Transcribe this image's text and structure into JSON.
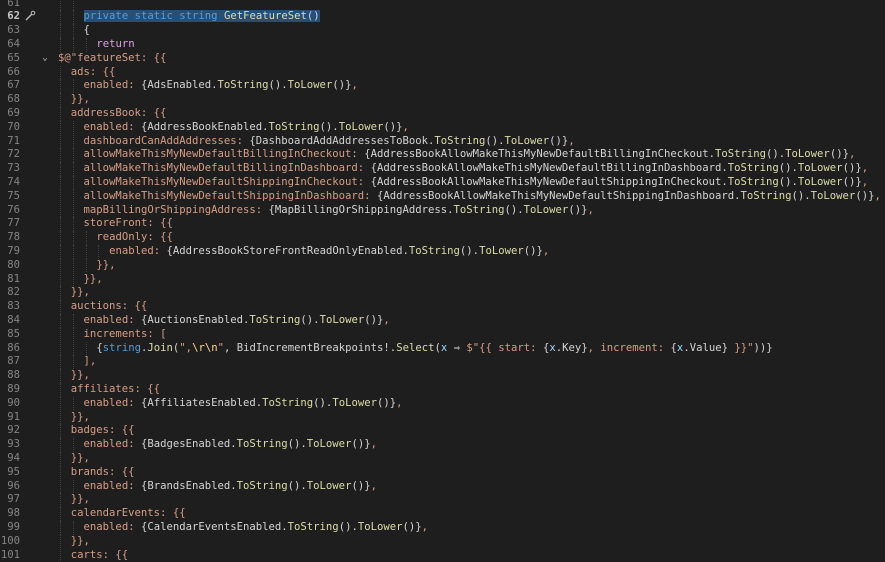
{
  "editor": {
    "active_line": 62,
    "lines": [
      {
        "n": 61,
        "indent": 4,
        "segs": []
      },
      {
        "n": 62,
        "indent": 4,
        "segs": [
          [
            "kw",
            "private"
          ],
          [
            "pl",
            " "
          ],
          [
            "kw",
            "static"
          ],
          [
            "pl",
            " "
          ],
          [
            "kw",
            "string"
          ],
          [
            "pl",
            " "
          ],
          [
            "fn",
            "GetFeatureSet"
          ],
          [
            "pl",
            "()"
          ]
        ],
        "selected": true
      },
      {
        "n": 63,
        "indent": 4,
        "segs": [
          [
            "pl",
            "{"
          ]
        ]
      },
      {
        "n": 64,
        "indent": 6,
        "segs": [
          [
            "ctl",
            "return"
          ]
        ]
      },
      {
        "n": 65,
        "indent": 0,
        "segs": [
          [
            "str",
            "$@\"featureSet: {{"
          ]
        ],
        "fold": true
      },
      {
        "n": 66,
        "indent": 2,
        "segs": [
          [
            "txt",
            "ads: {{"
          ]
        ]
      },
      {
        "n": 67,
        "indent": 4,
        "segs": [
          [
            "txt",
            "enabled: "
          ],
          [
            "pl",
            "{AdsEnabled."
          ],
          [
            "fn",
            "ToString"
          ],
          [
            "pl",
            "()."
          ],
          [
            "fn",
            "ToLower"
          ],
          [
            "pl",
            "()}"
          ],
          [
            "txt",
            ","
          ]
        ]
      },
      {
        "n": 68,
        "indent": 2,
        "segs": [
          [
            "txt",
            "}},"
          ]
        ]
      },
      {
        "n": 69,
        "indent": 2,
        "segs": [
          [
            "txt",
            "addressBook: {{"
          ]
        ]
      },
      {
        "n": 70,
        "indent": 4,
        "segs": [
          [
            "txt",
            "enabled: "
          ],
          [
            "pl",
            "{AddressBookEnabled."
          ],
          [
            "fn",
            "ToString"
          ],
          [
            "pl",
            "()."
          ],
          [
            "fn",
            "ToLower"
          ],
          [
            "pl",
            "()}"
          ],
          [
            "txt",
            ","
          ]
        ]
      },
      {
        "n": 71,
        "indent": 4,
        "segs": [
          [
            "txt",
            "dashboardCanAddAddresses: "
          ],
          [
            "pl",
            "{DashboardAddAddressesToBook."
          ],
          [
            "fn",
            "ToString"
          ],
          [
            "pl",
            "()."
          ],
          [
            "fn",
            "ToLower"
          ],
          [
            "pl",
            "()}"
          ],
          [
            "txt",
            ","
          ]
        ]
      },
      {
        "n": 72,
        "indent": 4,
        "segs": [
          [
            "txt",
            "allowMakeThisMyNewDefaultBillingInCheckout: "
          ],
          [
            "pl",
            "{AddressBookAllowMakeThisMyNewDefaultBillingInCheckout."
          ],
          [
            "fn",
            "ToString"
          ],
          [
            "pl",
            "()."
          ],
          [
            "fn",
            "ToLower"
          ],
          [
            "pl",
            "()}"
          ],
          [
            "txt",
            ","
          ]
        ]
      },
      {
        "n": 73,
        "indent": 4,
        "segs": [
          [
            "txt",
            "allowMakeThisMyNewDefaultBillingInDashboard: "
          ],
          [
            "pl",
            "{AddressBookAllowMakeThisMyNewDefaultBillingInDashboard."
          ],
          [
            "fn",
            "ToString"
          ],
          [
            "pl",
            "()."
          ],
          [
            "fn",
            "ToLower"
          ],
          [
            "pl",
            "()}"
          ],
          [
            "txt",
            ","
          ]
        ]
      },
      {
        "n": 74,
        "indent": 4,
        "segs": [
          [
            "txt",
            "allowMakeThisMyNewDefaultShippingInCheckout: "
          ],
          [
            "pl",
            "{AddressBookAllowMakeThisMyNewDefaultShippingInCheckout."
          ],
          [
            "fn",
            "ToString"
          ],
          [
            "pl",
            "()."
          ],
          [
            "fn",
            "ToLower"
          ],
          [
            "pl",
            "()}"
          ],
          [
            "txt",
            ","
          ]
        ]
      },
      {
        "n": 75,
        "indent": 4,
        "segs": [
          [
            "txt",
            "allowMakeThisMyNewDefaultShippingInDashboard: "
          ],
          [
            "pl",
            "{AddressBookAllowMakeThisMyNewDefaultShippingInDashboard."
          ],
          [
            "fn",
            "ToString"
          ],
          [
            "pl",
            "()."
          ],
          [
            "fn",
            "ToLower"
          ],
          [
            "pl",
            "()}"
          ],
          [
            "txt",
            ","
          ]
        ]
      },
      {
        "n": 76,
        "indent": 4,
        "segs": [
          [
            "txt",
            "mapBillingOrShippingAddress: "
          ],
          [
            "pl",
            "{MapBillingOrShippingAddress."
          ],
          [
            "fn",
            "ToString"
          ],
          [
            "pl",
            "()."
          ],
          [
            "fn",
            "ToLower"
          ],
          [
            "pl",
            "()}"
          ],
          [
            "txt",
            ","
          ]
        ]
      },
      {
        "n": 77,
        "indent": 4,
        "segs": [
          [
            "txt",
            "storeFront: {{"
          ]
        ]
      },
      {
        "n": 78,
        "indent": 6,
        "segs": [
          [
            "txt",
            "readOnly: {{"
          ]
        ]
      },
      {
        "n": 79,
        "indent": 8,
        "segs": [
          [
            "txt",
            "enabled: "
          ],
          [
            "pl",
            "{AddressBookStoreFrontReadOnlyEnabled."
          ],
          [
            "fn",
            "ToString"
          ],
          [
            "pl",
            "()."
          ],
          [
            "fn",
            "ToLower"
          ],
          [
            "pl",
            "()}"
          ],
          [
            "txt",
            ","
          ]
        ]
      },
      {
        "n": 80,
        "indent": 6,
        "segs": [
          [
            "txt",
            "}},"
          ]
        ]
      },
      {
        "n": 81,
        "indent": 4,
        "segs": [
          [
            "txt",
            "}},"
          ]
        ]
      },
      {
        "n": 82,
        "indent": 2,
        "segs": [
          [
            "txt",
            "}},"
          ]
        ]
      },
      {
        "n": 83,
        "indent": 2,
        "segs": [
          [
            "txt",
            "auctions: {{"
          ]
        ]
      },
      {
        "n": 84,
        "indent": 4,
        "segs": [
          [
            "txt",
            "enabled: "
          ],
          [
            "pl",
            "{AuctionsEnabled."
          ],
          [
            "fn",
            "ToString"
          ],
          [
            "pl",
            "()."
          ],
          [
            "fn",
            "ToLower"
          ],
          [
            "pl",
            "()}"
          ],
          [
            "txt",
            ","
          ]
        ]
      },
      {
        "n": 85,
        "indent": 4,
        "segs": [
          [
            "txt",
            "increments: ["
          ]
        ]
      },
      {
        "n": 86,
        "indent": 6,
        "segs": [
          [
            "pl",
            "{"
          ],
          [
            "kw",
            "string"
          ],
          [
            "pl",
            "."
          ],
          [
            "fn",
            "Join"
          ],
          [
            "pl",
            "("
          ],
          [
            "str",
            "\","
          ],
          [
            "esc",
            "\\r\\n"
          ],
          [
            "str",
            "\""
          ],
          [
            "pl",
            ", BidIncrementBreakpoints!."
          ],
          [
            "fn",
            "Select"
          ],
          [
            "pl",
            "("
          ],
          [
            "lv",
            "x"
          ],
          [
            "pl",
            " ⇒ "
          ],
          [
            "str",
            "$\"{{ start: "
          ],
          [
            "pl",
            "{"
          ],
          [
            "lv",
            "x"
          ],
          [
            "pl",
            ".Key}"
          ],
          [
            "str",
            ", increment: "
          ],
          [
            "pl",
            "{"
          ],
          [
            "lv",
            "x"
          ],
          [
            "pl",
            ".Value}"
          ],
          [
            "str",
            " }}\""
          ],
          [
            "pl",
            "))}"
          ]
        ]
      },
      {
        "n": 87,
        "indent": 4,
        "segs": [
          [
            "txt",
            "],"
          ]
        ]
      },
      {
        "n": 88,
        "indent": 2,
        "segs": [
          [
            "txt",
            "}},"
          ]
        ]
      },
      {
        "n": 89,
        "indent": 2,
        "segs": [
          [
            "txt",
            "affiliates: {{"
          ]
        ]
      },
      {
        "n": 90,
        "indent": 4,
        "segs": [
          [
            "txt",
            "enabled: "
          ],
          [
            "pl",
            "{AffiliatesEnabled."
          ],
          [
            "fn",
            "ToString"
          ],
          [
            "pl",
            "()."
          ],
          [
            "fn",
            "ToLower"
          ],
          [
            "pl",
            "()}"
          ],
          [
            "txt",
            ","
          ]
        ]
      },
      {
        "n": 91,
        "indent": 2,
        "segs": [
          [
            "txt",
            "}},"
          ]
        ]
      },
      {
        "n": 92,
        "indent": 2,
        "segs": [
          [
            "txt",
            "badges: {{"
          ]
        ]
      },
      {
        "n": 93,
        "indent": 4,
        "segs": [
          [
            "txt",
            "enabled: "
          ],
          [
            "pl",
            "{BadgesEnabled."
          ],
          [
            "fn",
            "ToString"
          ],
          [
            "pl",
            "()."
          ],
          [
            "fn",
            "ToLower"
          ],
          [
            "pl",
            "()}"
          ],
          [
            "txt",
            ","
          ]
        ]
      },
      {
        "n": 94,
        "indent": 2,
        "segs": [
          [
            "txt",
            "}},"
          ]
        ]
      },
      {
        "n": 95,
        "indent": 2,
        "segs": [
          [
            "txt",
            "brands: {{"
          ]
        ]
      },
      {
        "n": 96,
        "indent": 4,
        "segs": [
          [
            "txt",
            "enabled: "
          ],
          [
            "pl",
            "{BrandsEnabled."
          ],
          [
            "fn",
            "ToString"
          ],
          [
            "pl",
            "()."
          ],
          [
            "fn",
            "ToLower"
          ],
          [
            "pl",
            "()}"
          ],
          [
            "txt",
            ","
          ]
        ]
      },
      {
        "n": 97,
        "indent": 2,
        "segs": [
          [
            "txt",
            "}},"
          ]
        ]
      },
      {
        "n": 98,
        "indent": 2,
        "segs": [
          [
            "txt",
            "calendarEvents: {{"
          ]
        ]
      },
      {
        "n": 99,
        "indent": 4,
        "segs": [
          [
            "txt",
            "enabled: "
          ],
          [
            "pl",
            "{CalendarEventsEnabled."
          ],
          [
            "fn",
            "ToString"
          ],
          [
            "pl",
            "()."
          ],
          [
            "fn",
            "ToLower"
          ],
          [
            "pl",
            "()}"
          ],
          [
            "txt",
            ","
          ]
        ]
      },
      {
        "n": 100,
        "indent": 2,
        "segs": [
          [
            "txt",
            "}},"
          ]
        ]
      },
      {
        "n": 101,
        "indent": 2,
        "segs": [
          [
            "txt",
            "carts: {{"
          ]
        ]
      }
    ]
  }
}
